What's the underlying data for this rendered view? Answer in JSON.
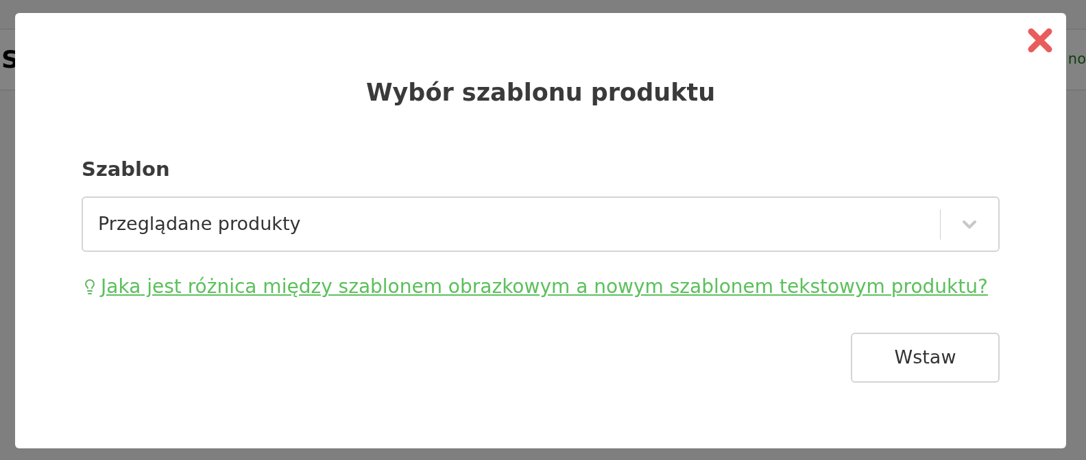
{
  "background": {
    "left_text": "S",
    "right_text": "no"
  },
  "dialog": {
    "title": "Wybór szablonu produktu",
    "field_label": "Szablon",
    "select_value": "Przeglądane produkty",
    "help_link": "Jaka jest różnica między szablonem obrazkowym a nowym szablonem tekstowym produktu?",
    "buttons": [
      "Wstaw"
    ]
  }
}
